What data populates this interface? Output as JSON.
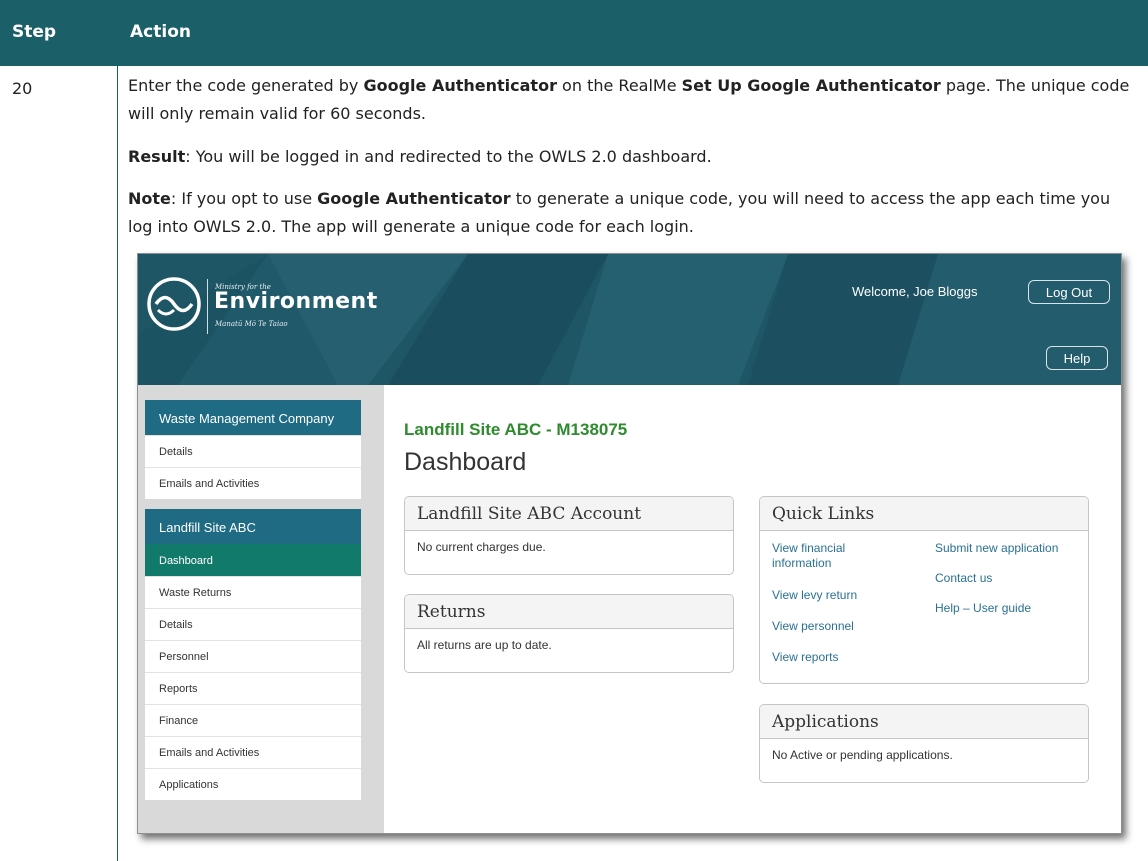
{
  "table": {
    "header": {
      "step": "Step",
      "action": "Action"
    },
    "step_number": "20",
    "paragraph1": {
      "t1": "Enter the code generated by ",
      "b1": "Google Authenticator",
      "t2": " on the RealMe ",
      "b2": "Set Up Google Authenticator",
      "t3": " page. The unique code will only remain valid for 60 seconds."
    },
    "paragraph2": {
      "b1": "Result",
      "t1": ": You will be logged in and redirected to the OWLS 2.0 dashboard."
    },
    "paragraph3": {
      "b1": "Note",
      "t1": ": If you opt to use ",
      "b2": "Google Authenticator",
      "t2": " to generate a unique code, you will need to access the app each time you log into OWLS 2.0. The app will generate a unique code for each login."
    }
  },
  "screenshot": {
    "logo": {
      "small_line": "Ministry for the",
      "main_line": "Environment",
      "maori_line": "Manatū Mō Te Taiao"
    },
    "welcome": "Welcome, Joe Bloggs",
    "logout_label": "Log Out",
    "help_label": "Help",
    "sidebar": {
      "company": {
        "heading": "Waste Management Company",
        "items": [
          "Details",
          "Emails and Activities"
        ]
      },
      "site": {
        "heading": "Landfill Site ABC",
        "items": [
          "Dashboard",
          "Waste Returns",
          "Details",
          "Personnel",
          "Reports",
          "Finance",
          "Emails and Activities",
          "Applications"
        ],
        "active": "Dashboard"
      }
    },
    "main": {
      "site_title": "Landfill Site ABC - M138075",
      "page_title": "Dashboard",
      "account_panel": {
        "heading": "Landfill Site ABC Account",
        "body": "No current charges due."
      },
      "returns_panel": {
        "heading": "Returns",
        "body": "All returns are up to date."
      },
      "quick_links": {
        "heading": "Quick Links",
        "left": [
          "View financial information",
          "View levy return",
          "View personnel",
          "View reports"
        ],
        "right": [
          "Submit new application",
          "Contact us",
          "Help – User guide"
        ]
      },
      "applications_panel": {
        "heading": "Applications",
        "body": "No Active or pending applications."
      }
    },
    "colors": {
      "banner": "#1f5666",
      "sidebar_heading": "#1f6b84",
      "active_item": "#127a6a",
      "site_title": "#2e8b2e",
      "link": "#2a7193",
      "table_header": "#1b5f69"
    }
  }
}
